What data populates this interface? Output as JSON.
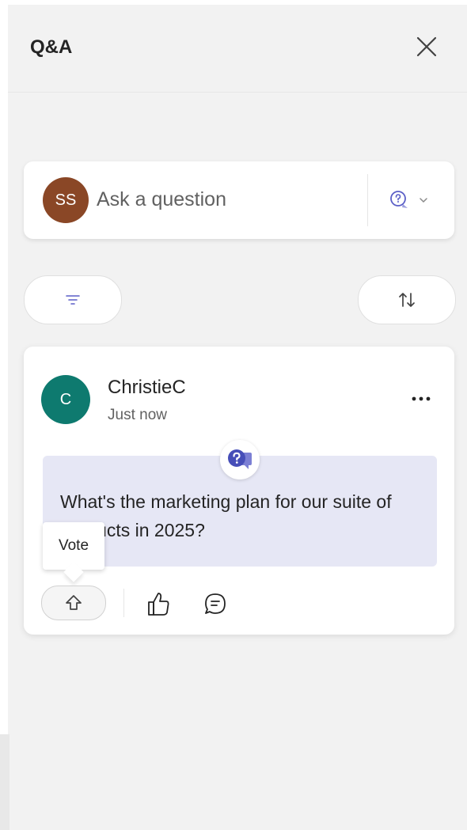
{
  "header": {
    "title": "Q&A",
    "close_icon": "close-icon"
  },
  "ask": {
    "avatar_initials": "SS",
    "avatar_color": "#8a4726",
    "placeholder": "Ask a question",
    "type_icon": "question-bubble-icon",
    "dropdown_icon": "chevron-down-icon"
  },
  "toolbar": {
    "filter_icon": "filter-icon",
    "sort_icon": "sort-icon"
  },
  "post": {
    "avatar_initial": "C",
    "avatar_color": "#0e7a6f",
    "author": "ChristieC",
    "time": "Just now",
    "more_icon": "more-icon",
    "badge_icon": "question-badge-icon",
    "question": "What's the marketing plan for our suite of products in 2025?",
    "tooltip": "Vote",
    "vote_icon": "upvote-arrow-icon",
    "like_icon": "like-icon",
    "reply_icon": "reply-icon"
  },
  "colors": {
    "accent": "#5b5fc7",
    "question_bg": "#e6e7f5",
    "panel_bg": "#f2f2f2"
  }
}
